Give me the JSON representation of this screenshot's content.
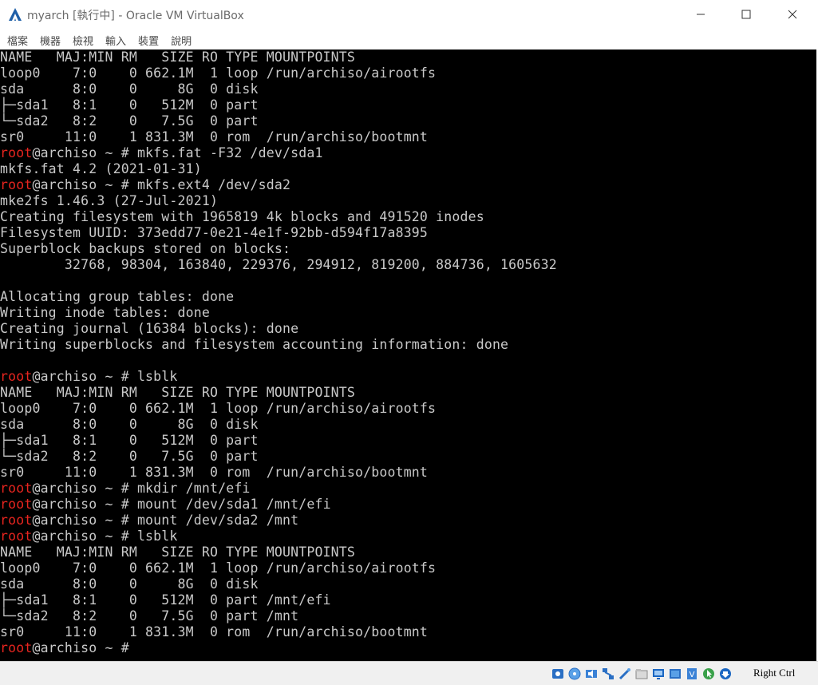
{
  "window": {
    "title": "myarch [執行中] - Oracle VM VirtualBox"
  },
  "menu": [
    "檔案",
    "機器",
    "檢視",
    "輸入",
    "裝置",
    "說明"
  ],
  "terminal": {
    "lines": [
      {
        "text": "NAME   MAJ:MIN RM   SIZE RO TYPE MOUNTPOINTS"
      },
      {
        "text": "loop0    7:0    0 662.1M  1 loop /run/archiso/airootfs"
      },
      {
        "text": "sda      8:0    0     8G  0 disk"
      },
      {
        "text": "├─sda1   8:1    0   512M  0 part"
      },
      {
        "text": "└─sda2   8:2    0   7.5G  0 part"
      },
      {
        "text": "sr0     11:0    1 831.3M  0 rom  /run/archiso/bootmnt"
      },
      {
        "user": "root",
        "text": "@archiso ~ # mkfs.fat -F32 /dev/sda1"
      },
      {
        "text": "mkfs.fat 4.2 (2021-01-31)"
      },
      {
        "user": "root",
        "text": "@archiso ~ # mkfs.ext4 /dev/sda2"
      },
      {
        "text": "mke2fs 1.46.3 (27-Jul-2021)"
      },
      {
        "text": "Creating filesystem with 1965819 4k blocks and 491520 inodes"
      },
      {
        "text": "Filesystem UUID: 373edd77-0e21-4e1f-92bb-d594f17a8395"
      },
      {
        "text": "Superblock backups stored on blocks:"
      },
      {
        "text": "        32768, 98304, 163840, 229376, 294912, 819200, 884736, 1605632"
      },
      {
        "text": ""
      },
      {
        "text": "Allocating group tables: done"
      },
      {
        "text": "Writing inode tables: done"
      },
      {
        "text": "Creating journal (16384 blocks): done"
      },
      {
        "text": "Writing superblocks and filesystem accounting information: done"
      },
      {
        "text": ""
      },
      {
        "user": "root",
        "text": "@archiso ~ # lsblk"
      },
      {
        "text": "NAME   MAJ:MIN RM   SIZE RO TYPE MOUNTPOINTS"
      },
      {
        "text": "loop0    7:0    0 662.1M  1 loop /run/archiso/airootfs"
      },
      {
        "text": "sda      8:0    0     8G  0 disk"
      },
      {
        "text": "├─sda1   8:1    0   512M  0 part"
      },
      {
        "text": "└─sda2   8:2    0   7.5G  0 part"
      },
      {
        "text": "sr0     11:0    1 831.3M  0 rom  /run/archiso/bootmnt"
      },
      {
        "user": "root",
        "text": "@archiso ~ # mkdir /mnt/efi"
      },
      {
        "user": "root",
        "text": "@archiso ~ # mount /dev/sda1 /mnt/efi"
      },
      {
        "user": "root",
        "text": "@archiso ~ # mount /dev/sda2 /mnt"
      },
      {
        "user": "root",
        "text": "@archiso ~ # lsblk"
      },
      {
        "text": "NAME   MAJ:MIN RM   SIZE RO TYPE MOUNTPOINTS"
      },
      {
        "text": "loop0    7:0    0 662.1M  1 loop /run/archiso/airootfs"
      },
      {
        "text": "sda      8:0    0     8G  0 disk"
      },
      {
        "text": "├─sda1   8:1    0   512M  0 part /mnt/efi"
      },
      {
        "text": "└─sda2   8:2    0   7.5G  0 part /mnt"
      },
      {
        "text": "sr0     11:0    1 831.3M  0 rom  /run/archiso/bootmnt"
      },
      {
        "user": "root",
        "text": "@archiso ~ # "
      }
    ]
  },
  "statusbar": {
    "icons": [
      "hard-disk-icon",
      "optical-disk-icon",
      "audio-icon",
      "network-icon",
      "usb-icon",
      "shared-folder-icon",
      "display-icon",
      "recording-icon",
      "virtualization-icon",
      "mouse-integration-icon",
      "keyboard-capture-icon"
    ],
    "host_key": "Right Ctrl"
  },
  "colors": {
    "terminal_bg": "#000000",
    "terminal_fg": "#c9c9c9",
    "prompt_user": "#e8251f",
    "statusbar_bg": "#f0f0f0"
  }
}
